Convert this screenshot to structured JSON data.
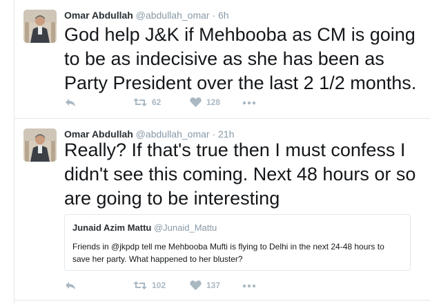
{
  "tweets": [
    {
      "fullname": "Omar Abdullah",
      "username": "@abdullah_omar",
      "separator": "·",
      "time": "6h",
      "text": "God help J&K if Mehbooba as CM is going to be as indecisive as she has been as Party President over the last 2 1/2 months.",
      "retweets": "62",
      "likes": "128"
    },
    {
      "fullname": "Omar Abdullah",
      "username": "@abdullah_omar",
      "separator": "·",
      "time": "21h",
      "text": "Really? If that's true then I must confess I didn't see this coming. Next 48 hours or so are going to be interesting",
      "quoted": {
        "fullname": "Junaid Azim Mattu",
        "username": "@Junaid_Mattu",
        "text": "Friends in @jkpdp tell me Mehbooba Mufti is flying to Delhi in the next 24-48 hours to save her party. What happened to her bluster?"
      },
      "retweets": "102",
      "likes": "137"
    }
  ],
  "icons": [
    "reply-icon",
    "retweet-icon",
    "like-icon",
    "more-icon"
  ],
  "colors": {
    "text": "#14171a",
    "meta": "#8899a6",
    "action": "#aab8c2",
    "border": "#e1e8ed"
  }
}
